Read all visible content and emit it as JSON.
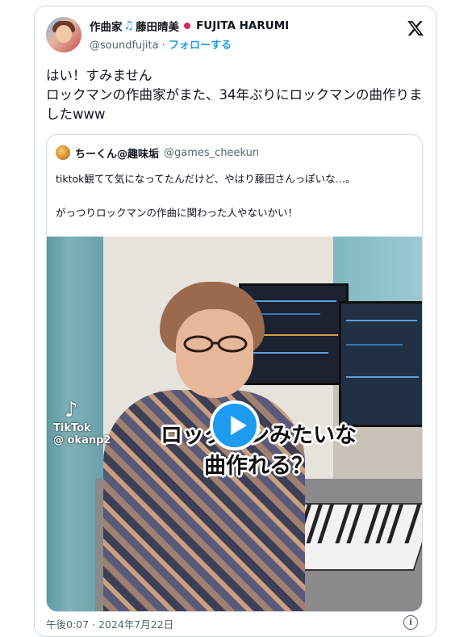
{
  "author": {
    "name_part1": "作曲家",
    "note_glyph": "♫",
    "name_part2": "藤田晴美",
    "name_latin": "FUJITA HARUMI",
    "handle": "@soundfujita",
    "separator": "·",
    "follow_label": "フォローする"
  },
  "tweet": {
    "lines": [
      "はい！すみません",
      "ロックマンの作曲家がまた、34年ぶりにロックマンの曲作りましたwww"
    ]
  },
  "quoted": {
    "name": "ちーくん@趣味垢",
    "handle": "@games_cheekun",
    "line1": "tiktok観てて気になってたんだけど、やはり藤田さんっぽいな…。",
    "line2": "がっつりロックマンの作曲に関わった人やないかい！"
  },
  "video": {
    "watermark_brand": "TikTok",
    "watermark_user": "@ okanp2",
    "caption_line1": "ロックマンみたいな",
    "caption_line2": "曲作れる？"
  },
  "footer": {
    "timestamp": "午後0:07 · 2024年7月22日",
    "info_glyph": "i"
  },
  "colors": {
    "accent": "#1d9bf0",
    "muted": "#536471",
    "border": "#cfd9de"
  },
  "icons": [
    "x-logo-icon",
    "music-note-icon",
    "red-dot-icon",
    "play-icon",
    "tiktok-icon",
    "info-icon"
  ]
}
